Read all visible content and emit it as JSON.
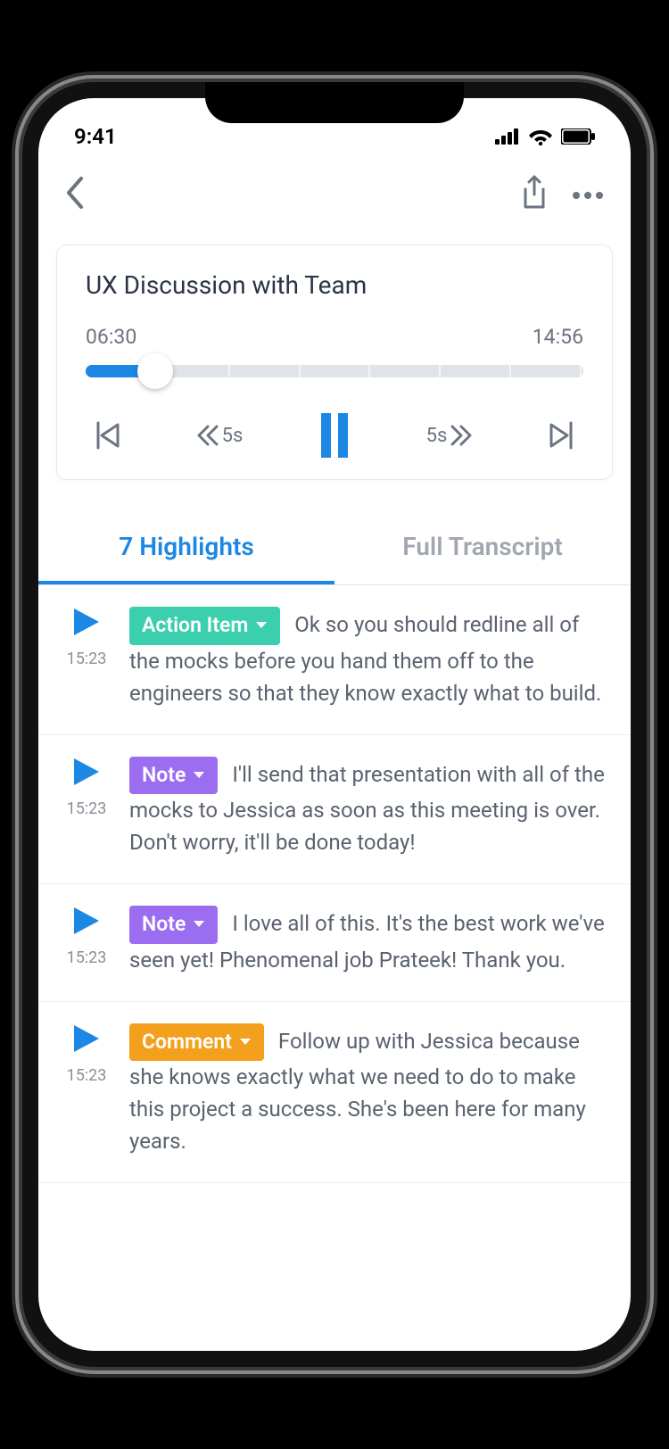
{
  "status": {
    "time": "9:41"
  },
  "player": {
    "title": "UX Discussion with Team",
    "elapsed": "06:30",
    "total": "14:56",
    "skip_back_label": "5s",
    "skip_fwd_label": "5s"
  },
  "tabs": {
    "highlights": "7 Highlights",
    "transcript": "Full Transcript"
  },
  "tag_labels": {
    "action": "Action Item",
    "note": "Note",
    "comment": "Comment"
  },
  "items": [
    {
      "time": "15:23",
      "tag": "action",
      "text": "Ok so you should redline all of the mocks before you hand them off to the engineers so that they know exactly what to build."
    },
    {
      "time": "15:23",
      "tag": "note",
      "text": "I'll send that presentation with all of the mocks to Jessica as soon as this meeting is over. Don't worry, it'll be done today!"
    },
    {
      "time": "15:23",
      "tag": "note",
      "text": "I love all of this. It's the best work we've seen yet! Phenomenal job Prateek! Thank you."
    },
    {
      "time": "15:23",
      "tag": "comment",
      "text": "Follow up with Jessica because she knows exactly what we need to do to make this project a success. She's been here for many years."
    }
  ]
}
